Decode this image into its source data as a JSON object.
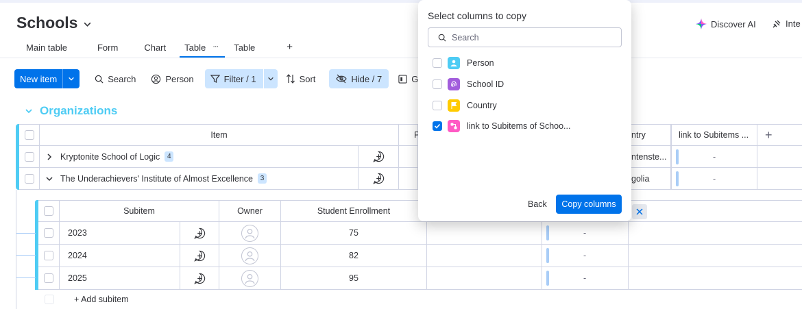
{
  "board": {
    "title": "Schools",
    "discover_ai": "Discover AI",
    "integrate": "Inte"
  },
  "tabs": [
    {
      "label": "Main table"
    },
    {
      "label": "Form"
    },
    {
      "label": "Chart"
    },
    {
      "label": "Table",
      "active": true,
      "more": "···"
    },
    {
      "label": "Table"
    },
    {
      "label": "+"
    }
  ],
  "toolbar": {
    "new_item": "New item",
    "search": "Search",
    "person": "Person",
    "filter": "Filter / 1",
    "sort": "Sort",
    "hide": "Hide / 7",
    "group": "G"
  },
  "group": {
    "name": "Organizations",
    "color": "#4eccf4"
  },
  "main_table": {
    "columns": {
      "item": "Item",
      "partial_p": "P",
      "country_partial": "ntry",
      "link_col": "link to Subitems ...",
      "add": "+"
    },
    "rows": [
      {
        "name": "Kryptonite School of Logic",
        "count": "4",
        "country_partial": "ntenste...",
        "link": "-"
      },
      {
        "name": "The Underachievers' Institute of Almost Excellence",
        "count": "3",
        "country_partial": "golia",
        "link": "-"
      }
    ]
  },
  "subitems": {
    "columns": {
      "subitem": "Subitem",
      "owner": "Owner",
      "enrollment": "Student Enrollment"
    },
    "rows": [
      {
        "name": "2023",
        "enrollment": "75",
        "link": "-"
      },
      {
        "name": "2024",
        "enrollment": "82",
        "link": "-"
      },
      {
        "name": "2025",
        "enrollment": "95",
        "link": "-"
      }
    ],
    "add_label": "+ Add subitem"
  },
  "popup": {
    "title": "Select columns to copy",
    "search_placeholder": "Search",
    "options": [
      {
        "label": "Person",
        "checked": false,
        "icon": "person-icon",
        "color": "#4eccf4"
      },
      {
        "label": "School ID",
        "checked": false,
        "icon": "fingerprint-icon",
        "color": "#a25ddc"
      },
      {
        "label": "Country",
        "checked": false,
        "icon": "flag-icon",
        "color": "#ffcb00"
      },
      {
        "label": "link to Subitems of Schoo...",
        "checked": true,
        "icon": "connect-boards-icon",
        "color": "#ff5ac4"
      }
    ],
    "back": "Back",
    "copy": "Copy columns"
  }
}
